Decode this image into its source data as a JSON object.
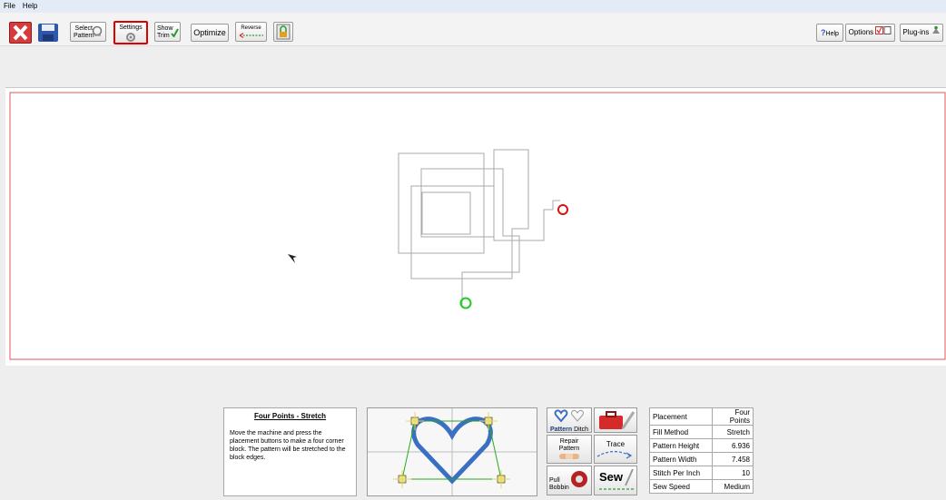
{
  "menu": {
    "file": "File",
    "help": "Help"
  },
  "toolbar": {
    "select_pattern_line1": "Select",
    "select_pattern_line2": "Pattern",
    "settings": "Settings",
    "show_trim_line1": "Show",
    "show_trim_line2": "Trim",
    "optimize": "Optimize",
    "reverse": "Reverse",
    "help": "Help",
    "options": "Options",
    "plugins": "Plug-ins"
  },
  "info_panel": {
    "title": "Four Points - Stretch",
    "description": "Move the machine and press the placement buttons to make a four corner block. The pattern will be stretched to the block edges."
  },
  "actions": {
    "pattern": "Pattern",
    "ditch": "Ditch",
    "repair_line1": "Repair",
    "repair_line2": "Pattern",
    "trace": "Trace",
    "pull_line1": "Pull",
    "pull_line2": "Bobbin",
    "sew": "Sew"
  },
  "properties": [
    {
      "key": "Placement",
      "value": "Four Points"
    },
    {
      "key": "Fill Method",
      "value": "Stretch"
    },
    {
      "key": "Pattern Height",
      "value": "6.936"
    },
    {
      "key": "Pattern Width",
      "value": "7.458"
    },
    {
      "key": "Stitch Per Inch",
      "value": "10"
    },
    {
      "key": "Sew Speed",
      "value": "Medium"
    }
  ],
  "colors": {
    "canvas_border": "#e05a5a",
    "highlight": "#e00000",
    "start_marker": "#22cc22",
    "end_marker": "#dd1111",
    "heart": "#3a6fc4",
    "bracket": "#22aa22"
  }
}
